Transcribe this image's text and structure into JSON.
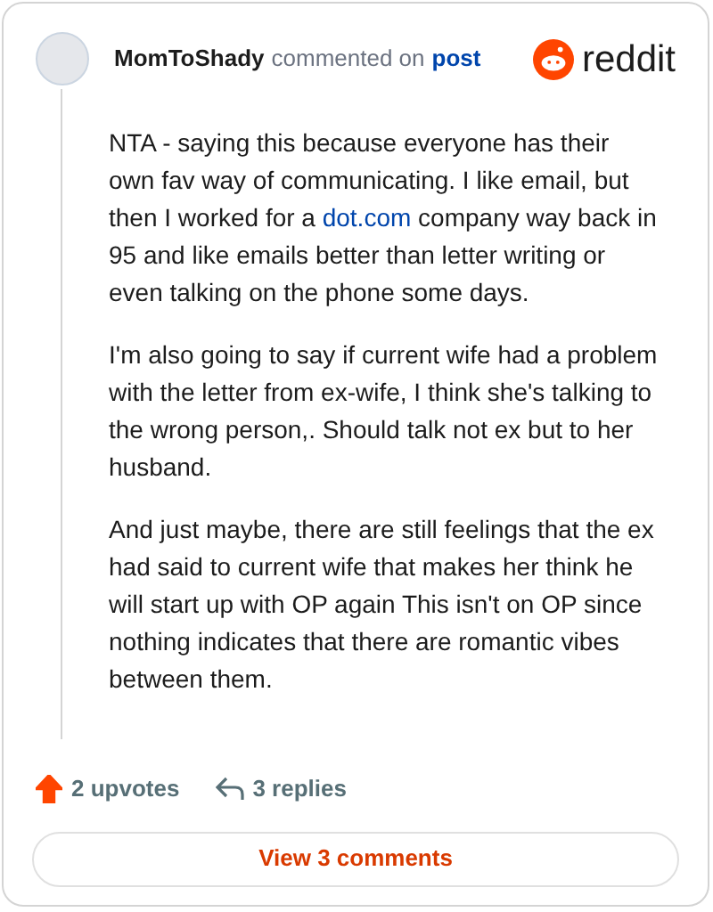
{
  "header": {
    "username": "MomToShady",
    "action": "commented on",
    "target": "post",
    "brand": "reddit"
  },
  "paragraphs": [
    {
      "parts": [
        {
          "kind": "text",
          "text": "NTA - saying this because everyone has their own fav way of communicating. I like email, but then I worked for a "
        },
        {
          "kind": "link",
          "text": "dot.com"
        },
        {
          "kind": "text",
          "text": " company way back in 95 and like emails better than letter writing or even talking on the phone some days."
        }
      ]
    },
    {
      "parts": [
        {
          "kind": "text",
          "text": "I'm also going to say if current wife had a problem with the letter from ex-wife, I think she's talking to the wrong person,. Should talk not ex but to her husband."
        }
      ]
    },
    {
      "parts": [
        {
          "kind": "text",
          "text": "And just maybe, there are still feelings that the ex had said to current wife that makes her think he will start up with OP again This isn't on OP since nothing indicates that there are romantic vibes between them."
        }
      ]
    }
  ],
  "footer": {
    "upvotes": "2 upvotes",
    "upvoted": true,
    "replies": "3 replies"
  },
  "view_button": "View 3 comments"
}
